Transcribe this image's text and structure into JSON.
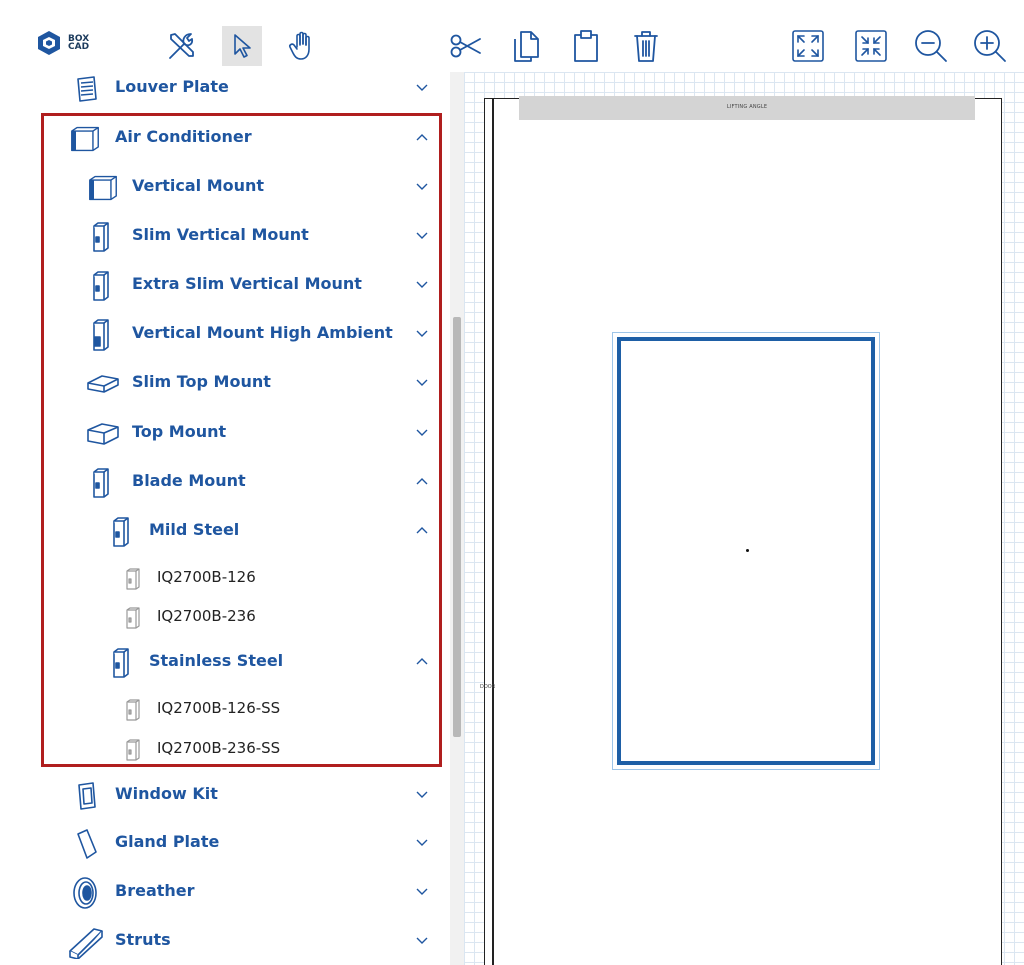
{
  "app": {
    "logo_text_line1": "BOX",
    "logo_text_line2": "CAD"
  },
  "toolbar": {
    "tools": [
      "tools-icon",
      "pointer-icon",
      "hand-icon"
    ],
    "edit": [
      "cut-icon",
      "copy-icon",
      "paste-icon",
      "delete-icon"
    ],
    "view": [
      "expand-icon",
      "collapse-icon",
      "zoom-out-icon",
      "zoom-in-icon"
    ],
    "active_tool": "pointer-icon"
  },
  "sidebar": {
    "items": [
      {
        "label": "Louver Plate"
      },
      {
        "label": "Air Conditioner"
      },
      {
        "label": "Vertical Mount"
      },
      {
        "label": "Slim Vertical Mount"
      },
      {
        "label": "Extra Slim Vertical Mount"
      },
      {
        "label": "Vertical Mount High Ambient"
      },
      {
        "label": "Slim Top Mount"
      },
      {
        "label": "Top Mount"
      },
      {
        "label": "Blade Mount"
      },
      {
        "label": "Mild Steel"
      },
      {
        "label": "IQ2700B-126"
      },
      {
        "label": "IQ2700B-236"
      },
      {
        "label": "Stainless Steel"
      },
      {
        "label": "IQ2700B-126-SS"
      },
      {
        "label": "IQ2700B-236-SS"
      },
      {
        "label": "Window Kit"
      },
      {
        "label": "Gland Plate"
      },
      {
        "label": "Breather"
      },
      {
        "label": "Struts"
      }
    ]
  },
  "canvas": {
    "lifting_label": "LIFTING ANGLE",
    "door_label": "DOOR"
  },
  "colors": {
    "accent": "#1f56a0",
    "highlight": "#b01e1e",
    "grid": "#dbe6f1"
  }
}
